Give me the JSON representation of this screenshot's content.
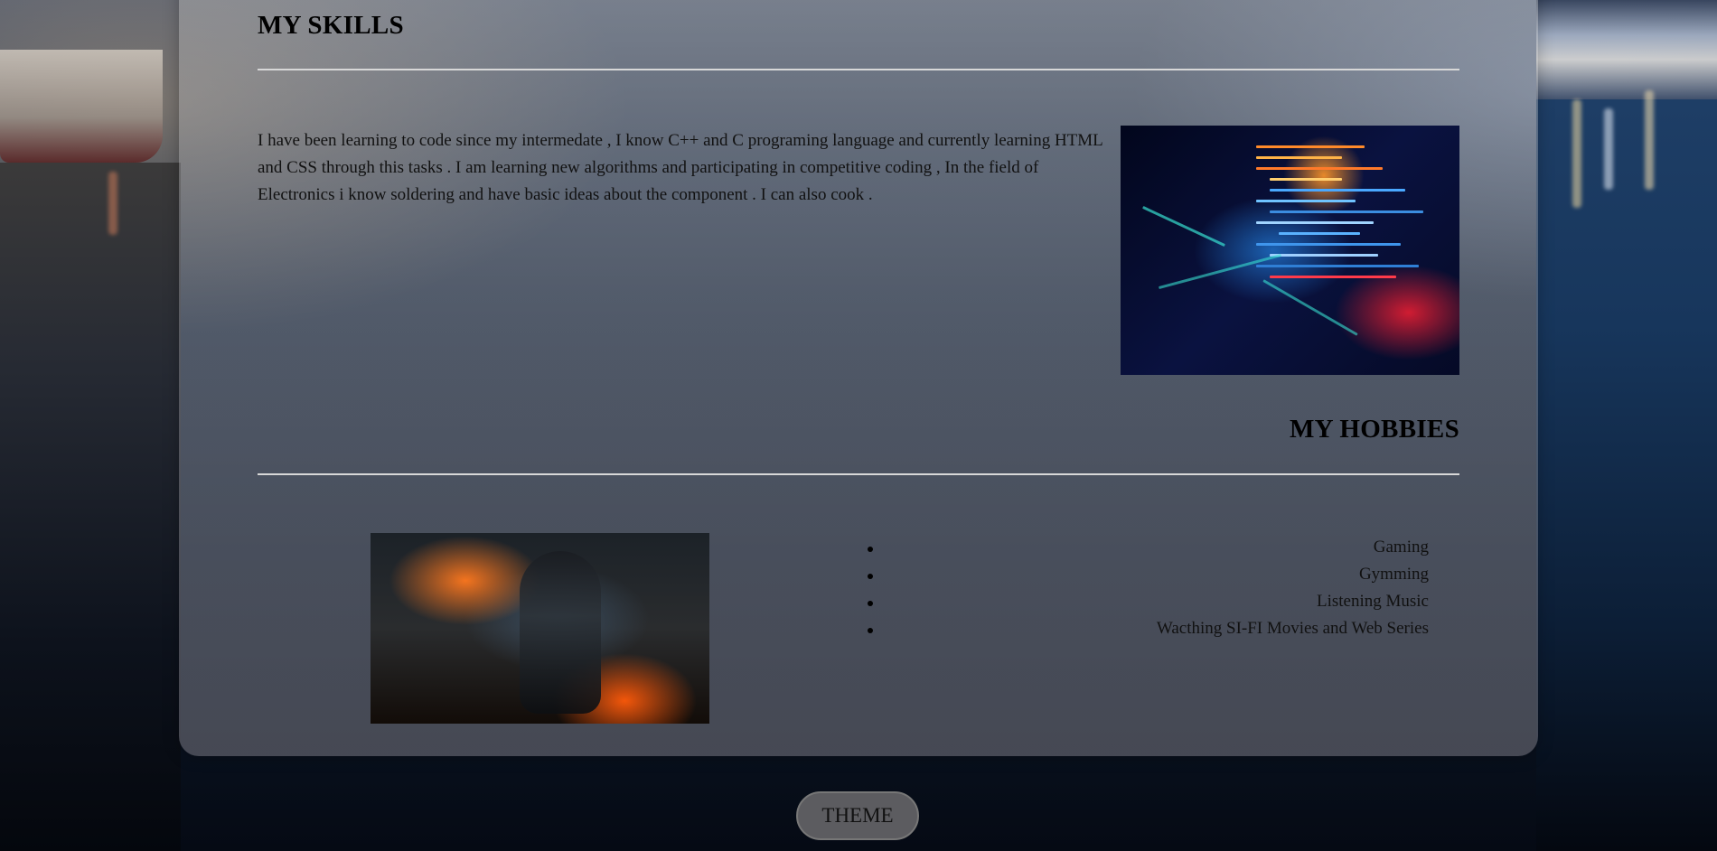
{
  "skills": {
    "title": "MY SKILLS",
    "text": "I have been learning to code since my intermedate , I know C++ and C programing language and currently learning HTML and CSS through this tasks . I am learning new algorithms and participating in competitive coding , In the field of Electronics i know soldering and have basic ideas about the component . I can also cook ."
  },
  "hobbies": {
    "title": "MY HOBBIES",
    "items": [
      "Gaming",
      "Gymming",
      "Listening Music",
      "Wacthing SI-FI Movies and Web Series"
    ]
  },
  "theme_button": {
    "label": "THEME"
  },
  "images": {
    "skills_image": "code-visualization-image",
    "hobbies_image": "game-soldier-image"
  }
}
